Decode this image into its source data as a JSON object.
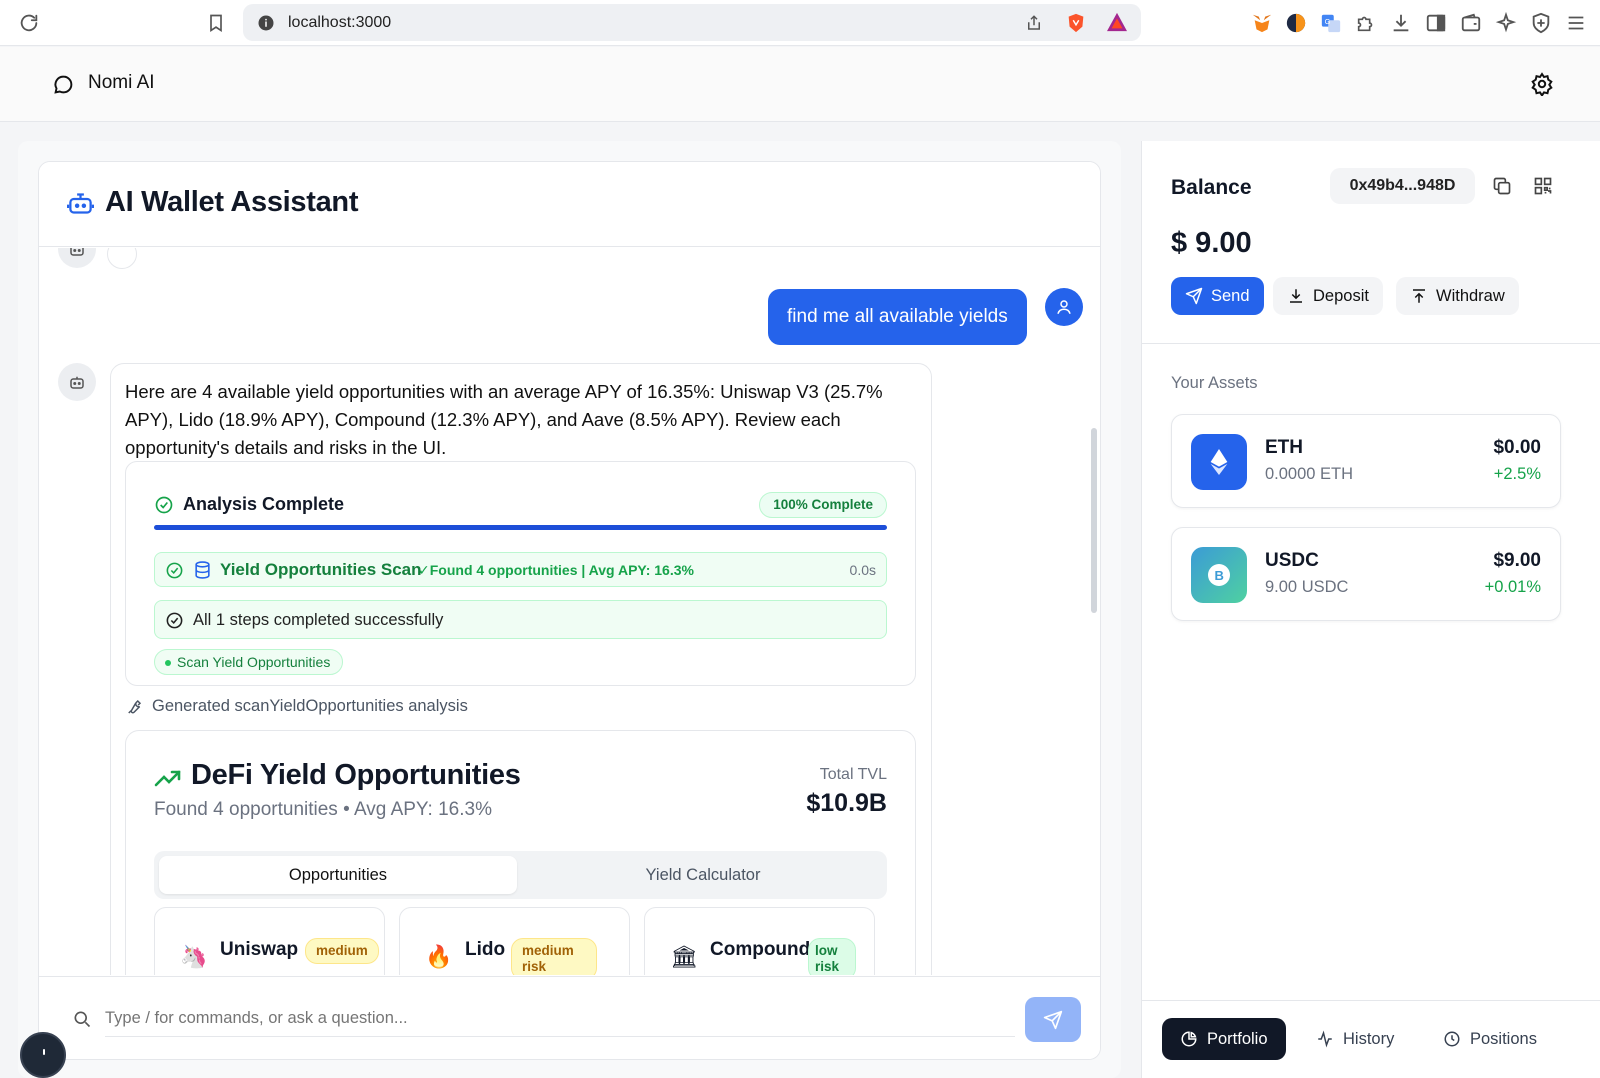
{
  "browser": {
    "url": "localhost:3000"
  },
  "app": {
    "title": "Nomi AI"
  },
  "chat": {
    "title": "AI Wallet Assistant",
    "user_message": "find me all available yields",
    "assistant_message": "Here are 4 available yield opportunities with an average APY of 16.35%: Uniswap V3 (25.7% APY), Lido (18.9% APY), Compound (12.3% APY), and Aave (8.5% APY). Review each opportunity's details and risks in the UI.",
    "analysis": {
      "title": "Analysis Complete",
      "progress_label": "100% Complete",
      "progress": 1.0,
      "step_name": "Yield Opportunities Scan",
      "step_result": "✓Found 4 opportunities | Avg APY: 16.3%",
      "step_time": "0.0s",
      "summary": "All 1 steps completed successfully",
      "tag": "Scan Yield Opportunities"
    },
    "generated_note": "Generated scanYieldOpportunities analysis",
    "defi": {
      "title": "DeFi Yield Opportunities",
      "subtitle": "Found 4 opportunities • Avg APY: 16.3%",
      "tvl_label": "Total TVL",
      "tvl_value": "$10.9B",
      "tabs": [
        "Opportunities",
        "Yield Calculator"
      ],
      "opportunities": [
        {
          "name": "Uniswap",
          "risk": "medium",
          "logo": "🦄"
        },
        {
          "name": "Lido",
          "risk": "medium risk",
          "logo": "🔥"
        },
        {
          "name": "Compound",
          "risk": "low risk",
          "logo": "🏛"
        }
      ]
    },
    "composer_placeholder": "Type / for commands, or ask a question..."
  },
  "wallet": {
    "balance_label": "Balance",
    "address": "0x49b4...948D",
    "amount": "$ 9.00",
    "buttons": {
      "send": "Send",
      "deposit": "Deposit",
      "withdraw": "Withdraw"
    },
    "assets_label": "Your Assets",
    "assets": [
      {
        "symbol": "ETH",
        "qty": "0.0000 ETH",
        "usd": "$0.00",
        "change": "+2.5%"
      },
      {
        "symbol": "USDC",
        "qty": "9.00 USDC",
        "usd": "$9.00",
        "change": "+0.01%"
      }
    ],
    "nav": [
      "Portfolio",
      "History",
      "Positions"
    ]
  },
  "colors": {
    "primary": "#2563eb",
    "success": "#16a34a",
    "dark": "#111827"
  }
}
